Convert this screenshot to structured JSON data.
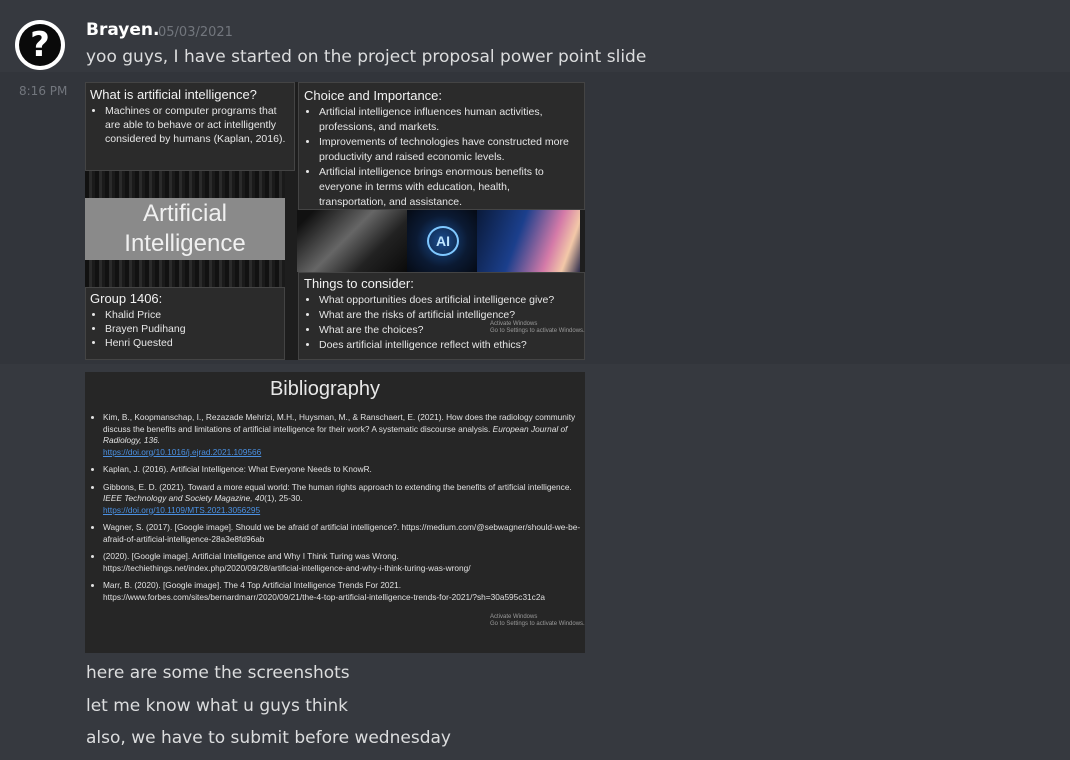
{
  "message": {
    "username": "Brayen.",
    "date": "05/03/2021",
    "lines": [
      "yoo guys, I have started on the project proposal power point slide",
      "here are some the screenshots",
      "let me know what u guys think",
      "also, we have to submit before wednesday"
    ],
    "side_time": "8:16 PM",
    "avatar_glyph": "?"
  },
  "slide1": {
    "what_title": "What is artificial intelligence?",
    "what_items": [
      "Machines or computer programs that are able to behave or act intelligently considered by humans (Kaplan, 2016)."
    ],
    "ai_title_line1": "Artificial",
    "ai_title_line2": "Intelligence",
    "group_title": "Group 1406:",
    "group_items": [
      "Khalid Price",
      "Brayen Pudihang",
      "Henri Quested"
    ],
    "choice_title": "Choice and Importance:",
    "choice_items": [
      "Artificial intelligence influences human activities, professions, and markets.",
      "Improvements of technologies have constructed more productivity and raised economic levels.",
      "Artificial intelligence brings enormous  benefits to everyone in terms with education, health, transportation, and assistance."
    ],
    "ai_badge": "AI",
    "things_title": "Things to consider:",
    "things_items": [
      "What opportunities does artificial intelligence give?",
      "What are the risks of artificial intelligence?",
      "What are the choices?",
      "Does artificial intelligence reflect with ethics?"
    ],
    "watermark_line1": "Activate Windows",
    "watermark_line2": "Go to Settings to activate Windows."
  },
  "slide2": {
    "title": "Bibliography",
    "entries": [
      {
        "text": "Kim, B., Koopmanschap, I., Rezazade Mehrizi, M.H., Huysman, M., & Ranschaert, E. (2021). How does the radiology community discuss the benefits and limitations of artificial intelligence for their work? A systematic discourse analysis. ",
        "italic": "European Journal of Radiology, 136.",
        "link": "https://doi.org/10.1016/j.ejrad.2021.109566"
      },
      {
        "text": "Kaplan, J. (2016). Artificial Intelligence: What Everyone Needs to KnowR.",
        "italic": "",
        "link": ""
      },
      {
        "text": "Gibbons, E. D. (2021). Toward a more equal world: The human rights approach to extending the benefits of artificial intelligence. ",
        "italic": "IEEE Technology and Society Magazine, 40",
        "after": "(1), 25-30.",
        "link": "https://doi.org/10.1109/MTS.2021.3056295"
      },
      {
        "text": "Wagner, S. (2017). [Google image]. Should we be afraid of artificial intelligence?. https://medium.com/@sebwagner/should-we-be-afraid-of-artificial-intelligence-28a3e8fd96ab",
        "italic": "",
        "link": ""
      },
      {
        "text": "(2020). [Google image]. Artificial Intelligence and Why I Think Turing was Wrong. https://techiethings.net/index.php/2020/09/28/artificial-intelligence-and-why-i-think-turing-was-wrong/",
        "italic": "",
        "link": ""
      },
      {
        "text": "Marr, B. (2020). [Google image]. The 4 Top Artificial Intelligence Trends For 2021. https://www.forbes.com/sites/bernardmarr/2020/09/21/the-4-top-artificial-intelligence-trends-for-2021/?sh=30a595c31c2a",
        "italic": "",
        "link": ""
      }
    ],
    "watermark_line1": "Activate Windows",
    "watermark_line2": "Go to Settings to activate Windows."
  }
}
